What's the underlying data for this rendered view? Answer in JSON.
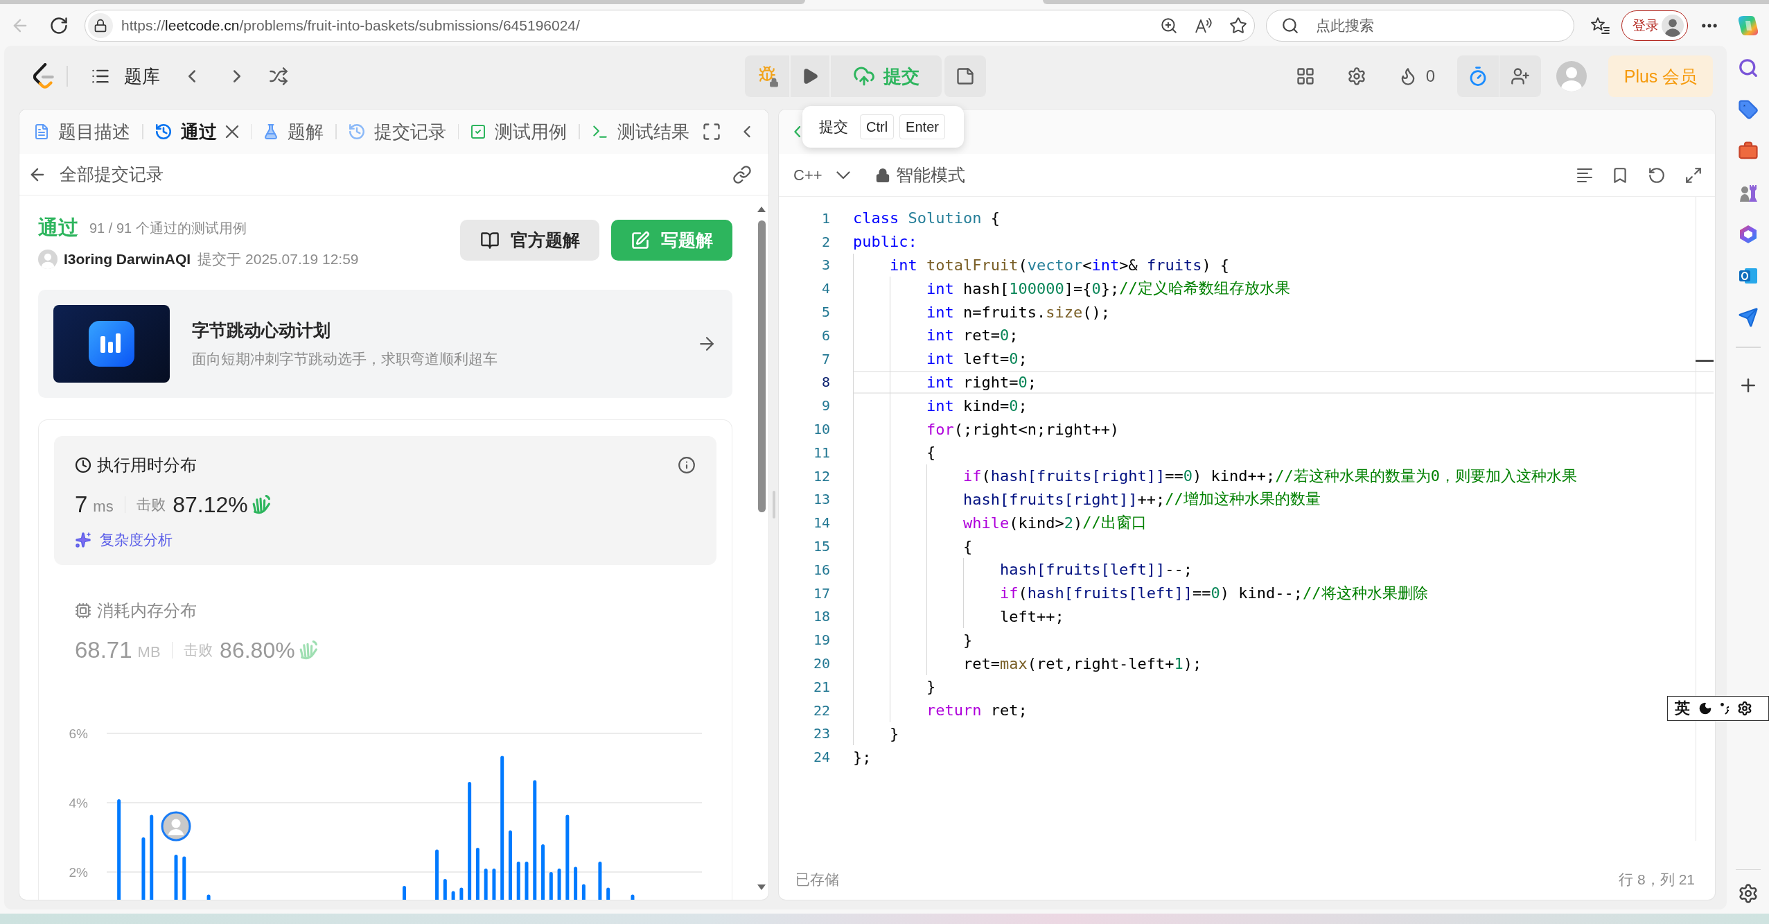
{
  "browser": {
    "back_disabled": true,
    "address": {
      "scheme": "https://",
      "host": "leetcode.cn",
      "path": "/problems/fruit-into-baskets/submissions/645196024/"
    },
    "search": {
      "placeholder": "点此搜索"
    },
    "login_button": "登录"
  },
  "header": {
    "problem_bank": "题库",
    "submit_button": "提交",
    "streak": "0",
    "plus_button": "Plus 会员"
  },
  "submission_panel": {
    "tabs": [
      {
        "kind": "description",
        "label": "题目描述",
        "selected": false,
        "closable": false
      },
      {
        "kind": "result",
        "label": "通过",
        "selected": true,
        "closable": true
      },
      {
        "kind": "solution",
        "label": "题解",
        "selected": false,
        "closable": false
      },
      {
        "kind": "submissions",
        "label": "提交记录",
        "selected": false,
        "closable": false
      },
      {
        "kind": "testcase",
        "label": "测试用例",
        "selected": false,
        "closable": false
      },
      {
        "kind": "testresult",
        "label": "测试结果",
        "selected": false,
        "closable": false
      }
    ],
    "back_link": "全部提交记录",
    "result": {
      "status": "通过",
      "summary": "91 / 91 个通过的测试用例",
      "user": "I3oring DarwinAQI",
      "submitted": "提交于 2025.07.19 12:59"
    },
    "actions": [
      {
        "kind": "secondary",
        "label": "官方题解"
      },
      {
        "kind": "primary",
        "label": "写题解"
      }
    ],
    "banner": {
      "title": "字节跳动心动计划",
      "subtitle": "面向短期冲刺字节跳动选手，求职弯道顺利超车"
    },
    "metrics": [
      {
        "kind": "runtime",
        "title": "执行用时分布",
        "value": "7",
        "unit": "ms",
        "beat_label": "击败",
        "beat": "87.12%",
        "selected": true,
        "link": "复杂度分析"
      },
      {
        "kind": "memory",
        "title": "消耗内存分布",
        "value": "68.71",
        "unit": "MB",
        "beat_label": "击败",
        "beat": "86.80%",
        "selected": false
      }
    ],
    "chart_data": {
      "type": "bar",
      "ylim": [
        1.2,
        6
      ],
      "yticks": [
        {
          "value": 2,
          "label": "2%"
        },
        {
          "value": 4,
          "label": "4%"
        },
        {
          "value": 6,
          "label": "6%"
        }
      ],
      "values": [
        null,
        4.1,
        null,
        null,
        3.0,
        3.65,
        null,
        null,
        2.5,
        2.45,
        null,
        null,
        1.35,
        null,
        null,
        null,
        null,
        null,
        null,
        null,
        null,
        null,
        null,
        null,
        null,
        null,
        null,
        null,
        null,
        null,
        null,
        null,
        null,
        null,
        null,
        null,
        1.6,
        null,
        null,
        null,
        2.65,
        1.8,
        1.45,
        1.55,
        4.6,
        2.7,
        2.1,
        2.1,
        5.35,
        3.2,
        2.3,
        2.3,
        4.65,
        2.8,
        2.0,
        2.1,
        3.65,
        2.15,
        1.65,
        null,
        2.3,
        1.55,
        null,
        null,
        1.35,
        null,
        null,
        null,
        null,
        null,
        null,
        null,
        null
      ]
    }
  },
  "editor": {
    "shortcut_tooltip": {
      "label": "提交",
      "keys": [
        "Ctrl",
        "Enter"
      ]
    },
    "language": "C++",
    "mode": "智能模式",
    "lines": [
      {
        "number": "1",
        "current": false,
        "tokens": [
          {
            "kind": "keyword",
            "text": "class"
          },
          {
            "kind": "type",
            "text": " Solution"
          },
          {
            "kind": "plain",
            "text": " {"
          }
        ]
      },
      {
        "number": "2",
        "current": false,
        "tokens": [
          {
            "kind": "keyword",
            "text": "public:"
          }
        ]
      },
      {
        "number": "3",
        "current": false,
        "tokens": [
          {
            "kind": "keyword",
            "text": "    int"
          },
          {
            "kind": "function",
            "text": " totalFruit"
          },
          {
            "kind": "plain",
            "text": "("
          },
          {
            "kind": "type",
            "text": "vector"
          },
          {
            "kind": "plain",
            "text": "<"
          },
          {
            "kind": "keyword",
            "text": "int"
          },
          {
            "kind": "plain",
            "text": ">&"
          },
          {
            "kind": "variable",
            "text": " fruits"
          },
          {
            "kind": "plain",
            "text": ") {"
          }
        ]
      },
      {
        "number": "4",
        "current": false,
        "tokens": [
          {
            "kind": "keyword",
            "text": "        int"
          },
          {
            "kind": "plain",
            "text": " hash["
          },
          {
            "kind": "number",
            "text": "100000"
          },
          {
            "kind": "plain",
            "text": "]={"
          },
          {
            "kind": "number",
            "text": "0"
          },
          {
            "kind": "plain",
            "text": "};"
          },
          {
            "kind": "comment",
            "text": "//定义哈希数组存放水果"
          }
        ]
      },
      {
        "number": "5",
        "current": false,
        "tokens": [
          {
            "kind": "keyword",
            "text": "        int"
          },
          {
            "kind": "plain",
            "text": " n=fruits."
          },
          {
            "kind": "function",
            "text": "size"
          },
          {
            "kind": "plain",
            "text": "();"
          }
        ]
      },
      {
        "number": "6",
        "current": false,
        "tokens": [
          {
            "kind": "keyword",
            "text": "        int"
          },
          {
            "kind": "plain",
            "text": " ret="
          },
          {
            "kind": "number",
            "text": "0"
          },
          {
            "kind": "plain",
            "text": ";"
          }
        ]
      },
      {
        "number": "7",
        "current": false,
        "tokens": [
          {
            "kind": "keyword",
            "text": "        int"
          },
          {
            "kind": "plain",
            "text": " left="
          },
          {
            "kind": "number",
            "text": "0"
          },
          {
            "kind": "plain",
            "text": ";"
          }
        ]
      },
      {
        "number": "8",
        "current": true,
        "tokens": [
          {
            "kind": "keyword",
            "text": "        int"
          },
          {
            "kind": "plain",
            "text": " right="
          },
          {
            "kind": "number",
            "text": "0"
          },
          {
            "kind": "plain",
            "text": ";"
          }
        ]
      },
      {
        "number": "9",
        "current": false,
        "tokens": [
          {
            "kind": "keyword",
            "text": "        int"
          },
          {
            "kind": "plain",
            "text": " kind="
          },
          {
            "kind": "number",
            "text": "0"
          },
          {
            "kind": "plain",
            "text": ";"
          }
        ]
      },
      {
        "number": "10",
        "current": false,
        "tokens": [
          {
            "kind": "control",
            "text": "        for"
          },
          {
            "kind": "plain",
            "text": "(;right<n;right++)"
          }
        ]
      },
      {
        "number": "11",
        "current": false,
        "tokens": [
          {
            "kind": "plain",
            "text": "        {"
          }
        ]
      },
      {
        "number": "12",
        "current": false,
        "tokens": [
          {
            "kind": "control",
            "text": "            if"
          },
          {
            "kind": "plain",
            "text": "("
          },
          {
            "kind": "variable",
            "text": "hash[fruits[right]]"
          },
          {
            "kind": "plain",
            "text": "=="
          },
          {
            "kind": "number",
            "text": "0"
          },
          {
            "kind": "plain",
            "text": ") kind++;"
          },
          {
            "kind": "comment",
            "text": "//若这种水果的数量为0，则要加入这种水果"
          }
        ]
      },
      {
        "number": "13",
        "current": false,
        "tokens": [
          {
            "kind": "variable",
            "text": "            hash[fruits[right]]"
          },
          {
            "kind": "plain",
            "text": "++;"
          },
          {
            "kind": "comment",
            "text": "//增加这种水果的数量"
          }
        ]
      },
      {
        "number": "14",
        "current": false,
        "tokens": [
          {
            "kind": "control",
            "text": "            while"
          },
          {
            "kind": "plain",
            "text": "(kind>"
          },
          {
            "kind": "number",
            "text": "2"
          },
          {
            "kind": "plain",
            "text": ")"
          },
          {
            "kind": "comment",
            "text": "//出窗口"
          }
        ]
      },
      {
        "number": "15",
        "current": false,
        "tokens": [
          {
            "kind": "plain",
            "text": "            {"
          }
        ]
      },
      {
        "number": "16",
        "current": false,
        "tokens": [
          {
            "kind": "variable",
            "text": "                hash[fruits[left]]"
          },
          {
            "kind": "plain",
            "text": "--;"
          }
        ]
      },
      {
        "number": "17",
        "current": false,
        "tokens": [
          {
            "kind": "control",
            "text": "                if"
          },
          {
            "kind": "plain",
            "text": "("
          },
          {
            "kind": "variable",
            "text": "hash[fruits[left]]"
          },
          {
            "kind": "plain",
            "text": "=="
          },
          {
            "kind": "number",
            "text": "0"
          },
          {
            "kind": "plain",
            "text": ") kind--;"
          },
          {
            "kind": "comment",
            "text": "//将这种水果删除"
          }
        ]
      },
      {
        "number": "18",
        "current": false,
        "tokens": [
          {
            "kind": "plain",
            "text": "                left++;"
          }
        ]
      },
      {
        "number": "19",
        "current": false,
        "tokens": [
          {
            "kind": "plain",
            "text": "            }"
          }
        ]
      },
      {
        "number": "20",
        "current": false,
        "tokens": [
          {
            "kind": "plain",
            "text": "            ret="
          },
          {
            "kind": "function",
            "text": "max"
          },
          {
            "kind": "plain",
            "text": "(ret,right-left+"
          },
          {
            "kind": "number",
            "text": "1"
          },
          {
            "kind": "plain",
            "text": ");"
          }
        ]
      },
      {
        "number": "21",
        "current": false,
        "tokens": [
          {
            "kind": "plain",
            "text": "        }"
          }
        ]
      },
      {
        "number": "22",
        "current": false,
        "tokens": [
          {
            "kind": "control",
            "text": "        return"
          },
          {
            "kind": "plain",
            "text": " ret;"
          }
        ]
      },
      {
        "number": "23",
        "current": false,
        "tokens": [
          {
            "kind": "plain",
            "text": "    }"
          }
        ]
      },
      {
        "number": "24",
        "current": false,
        "tokens": [
          {
            "kind": "plain",
            "text": "};"
          }
        ]
      }
    ],
    "save_status": "已存储",
    "cursor_position": "行 8，列 21"
  },
  "ime_toolbar": {
    "mode": "英"
  }
}
